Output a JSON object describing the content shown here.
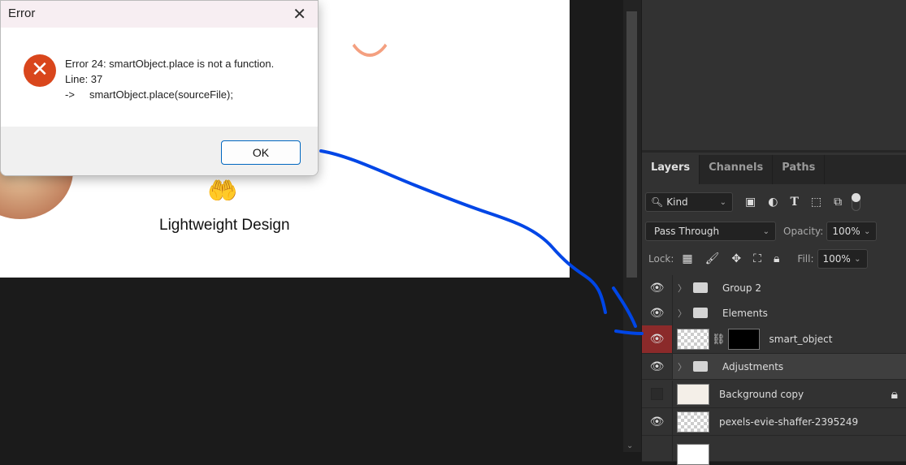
{
  "canvas": {
    "caption": "Lightweight Design"
  },
  "dialog": {
    "title": "Error",
    "message_line1": "Error 24: smartObject.place is not a function.",
    "message_line2": "Line: 37",
    "message_line3": "->     smartObject.place(sourceFile);",
    "ok_label": "OK"
  },
  "panel": {
    "tabs": [
      "Layers",
      "Channels",
      "Paths"
    ],
    "filter_kind": "Kind",
    "blend_mode": "Pass Through",
    "opacity_label": "Opacity:",
    "opacity": "100%",
    "lock_label": "Lock:",
    "fill_label": "Fill:",
    "fill": "100%",
    "layers": [
      {
        "name": "Group 2",
        "type": "group",
        "visible": true
      },
      {
        "name": "Elements",
        "type": "group",
        "visible": true
      },
      {
        "name": "smart_object",
        "type": "smart",
        "visible": true,
        "selected": true
      },
      {
        "name": "Adjustments",
        "type": "group",
        "visible": true
      },
      {
        "name": "Background copy",
        "type": "smart",
        "visible": false,
        "locked": true
      },
      {
        "name": "pexels-evie-shaffer-2395249",
        "type": "layer",
        "visible": true
      }
    ]
  },
  "colors": {
    "annotation": "#0046e6",
    "selected_eye": "#8b2a2a",
    "error_icon": "#d9461c"
  }
}
